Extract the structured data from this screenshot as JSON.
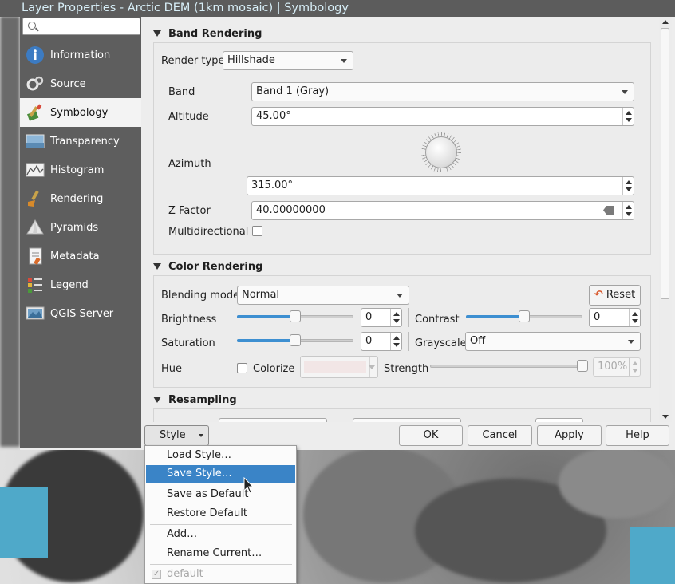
{
  "window": {
    "title": "Layer Properties - Arctic DEM (1km mosaic) | Symbology"
  },
  "sidebar": {
    "search_placeholder": "",
    "items": [
      {
        "label": "Information",
        "icon": "info-icon"
      },
      {
        "label": "Source",
        "icon": "source-icon"
      },
      {
        "label": "Symbology",
        "icon": "symbology-icon",
        "active": true
      },
      {
        "label": "Transparency",
        "icon": "transparency-icon"
      },
      {
        "label": "Histogram",
        "icon": "histogram-icon"
      },
      {
        "label": "Rendering",
        "icon": "rendering-icon"
      },
      {
        "label": "Pyramids",
        "icon": "pyramids-icon"
      },
      {
        "label": "Metadata",
        "icon": "metadata-icon"
      },
      {
        "label": "Legend",
        "icon": "legend-icon"
      },
      {
        "label": "QGIS Server",
        "icon": "qgis-server-icon"
      }
    ]
  },
  "band_rendering": {
    "title": "Band Rendering",
    "render_type_label": "Render type",
    "render_type_value": "Hillshade",
    "band_label": "Band",
    "band_value": "Band 1 (Gray)",
    "altitude_label": "Altitude",
    "altitude_value": "45.00°",
    "azimuth_label": "Azimuth",
    "azimuth_value": "315.00°",
    "zfactor_label": "Z Factor",
    "zfactor_value": "40.00000000",
    "multidirectional_label": "Multidirectional",
    "multidirectional_checked": false
  },
  "color_rendering": {
    "title": "Color Rendering",
    "blending_label": "Blending mode",
    "blending_value": "Normal",
    "reset_label": "Reset",
    "brightness_label": "Brightness",
    "brightness_value": "0",
    "contrast_label": "Contrast",
    "contrast_value": "0",
    "saturation_label": "Saturation",
    "saturation_value": "0",
    "grayscale_label": "Grayscale",
    "grayscale_value": "Off",
    "hue_label": "Hue",
    "colorize_label": "Colorize",
    "colorize_checked": false,
    "strength_label": "Strength",
    "strength_value": "100%",
    "colorize_swatch": "#f2e6e6"
  },
  "resampling": {
    "title": "Resampling"
  },
  "buttons": {
    "style": "Style",
    "ok": "OK",
    "cancel": "Cancel",
    "apply": "Apply",
    "help": "Help"
  },
  "style_menu": {
    "items": [
      {
        "label": "Load Style…"
      },
      {
        "label": "Save Style…",
        "highlighted": true
      },
      {
        "label": "Save as Default"
      },
      {
        "label": "Restore Default"
      },
      {
        "label": "Add…"
      },
      {
        "label": "Rename Current…"
      },
      {
        "label": "default",
        "checked": true,
        "disabled": true
      }
    ]
  },
  "colors": {
    "accent": "#3a84c7",
    "sidebar": "#5e5e5e",
    "titlebar": "#5c5c5c"
  }
}
